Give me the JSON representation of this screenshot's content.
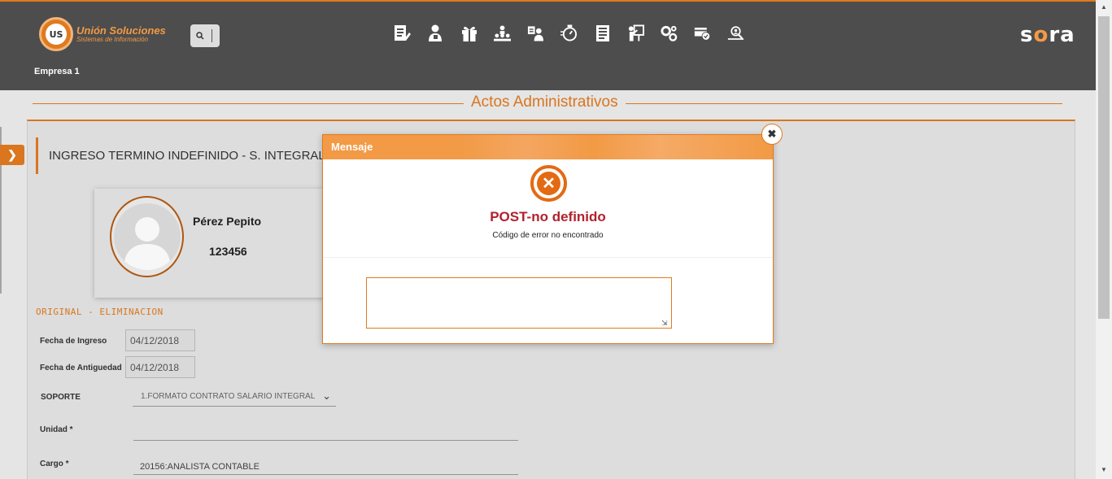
{
  "header": {
    "logo_line1": "Unión Soluciones",
    "logo_line2": "Sistemas de Información",
    "logo_badge": "US",
    "company": "Empresa 1",
    "brand_pre": "s",
    "brand_o": "o",
    "brand_post": "ra",
    "nav_icons": [
      "documents-edit-icon",
      "employee-icon",
      "gift-icon",
      "org-chart-icon",
      "team-icon",
      "timer-icon",
      "report-icon",
      "training-icon",
      "settings-gears-icon",
      "verified-icon",
      "search-people-icon"
    ]
  },
  "page": {
    "title": "Actos Administrativos"
  },
  "document": {
    "title": "INGRESO TERMINO INDEFINIDO - S. INTEGRAL",
    "person_name": "Pérez Pepito",
    "person_id": "123456",
    "section_title": "ORIGINAL - ELIMINACION",
    "fecha_ingreso_label": "Fecha de Ingreso",
    "fecha_ingreso": "04/12/2018",
    "fecha_antiguedad_label": "Fecha de Antiguedad",
    "fecha_antiguedad": "04/12/2018",
    "soporte_label": "SOPORTE",
    "soporte_value": "1.FORMATO CONTRATO SALARIO INTEGRAL",
    "unidad_label": "Unidad *",
    "unidad_value": "",
    "cargo_label": "Cargo *",
    "cargo_value": "20156:ANALISTA CONTABLE"
  },
  "modal": {
    "header": "Mensaje",
    "title": "POST-no definido",
    "subtitle": "Código de error no encontrado",
    "textarea_value": "",
    "close_glyph": "✖"
  },
  "colors": {
    "accent": "#e07a1f",
    "header_bg": "#4d4d4d",
    "error_title": "#b0222d"
  }
}
